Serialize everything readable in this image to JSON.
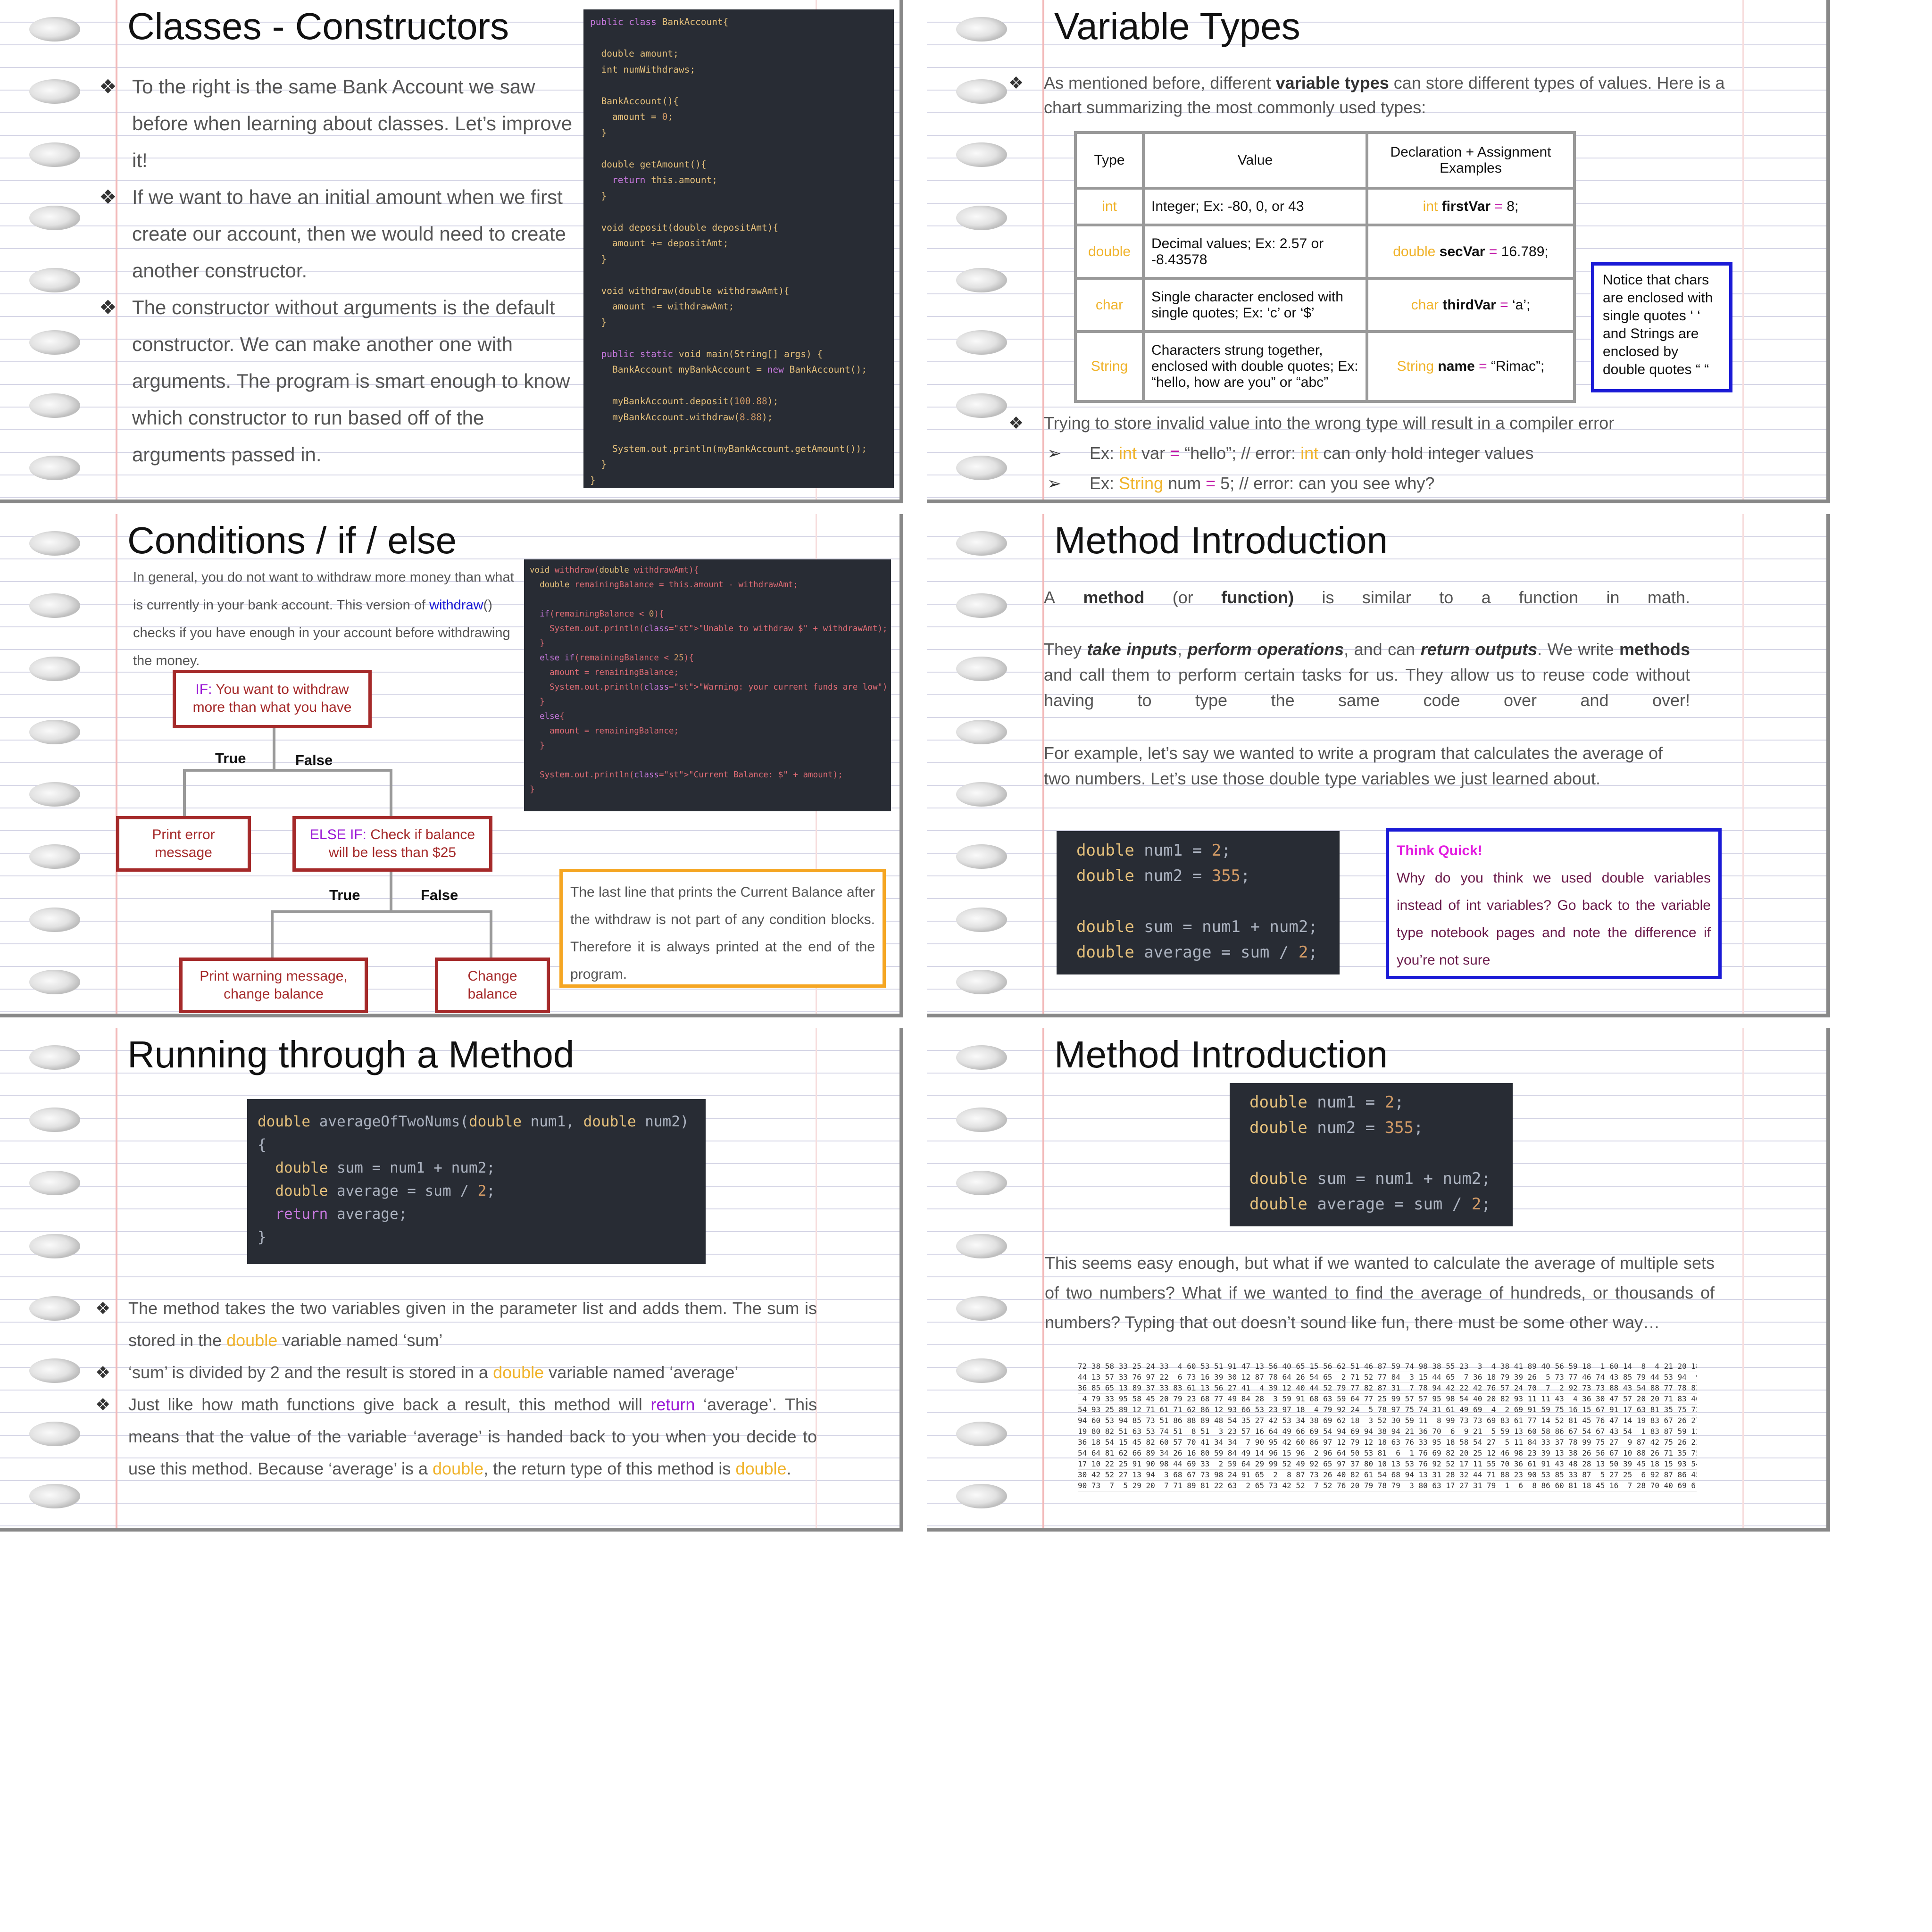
{
  "slides": {
    "constructors": {
      "title": "Classes - Constructors",
      "bullets": [
        "To the right is the same Bank Account we saw before when learning about classes. Let’s improve it!",
        "If we want to have an initial amount when we first create our account, then we would need to create another constructor.",
        "The constructor without arguments is the default constructor. We can make another one with arguments. The program is smart enough to know which constructor to run based off of the arguments passed in."
      ],
      "code": [
        "public class BankAccount{",
        "",
        "  double amount;",
        "  int numWithdraws;",
        "",
        "  BankAccount(){",
        "    amount = 0;",
        "  }",
        "",
        "  double getAmount(){",
        "    return this.amount;",
        "  }",
        "",
        "  void deposit(double depositAmt){",
        "    amount += depositAmt;",
        "  }",
        "",
        "  void withdraw(double withdrawAmt){",
        "    amount -= withdrawAmt;",
        "  }",
        "",
        "  public static void main(String[] args) {",
        "    BankAccount myBankAccount = new BankAccount();",
        "",
        "    myBankAccount.deposit(100.88);",
        "    myBankAccount.withdraw(8.88);",
        "",
        "    System.out.println(myBankAccount.getAmount());",
        "  }",
        "}"
      ]
    },
    "variable_types": {
      "title": "Variable Types",
      "intro_before": "As mentioned before, different ",
      "intro_bold": "variable types",
      "intro_after": " can store different types of values. Here is a chart summarizing the most commonly used types:",
      "table_headers": [
        "Type",
        "Value",
        "Declaration + Assignment Examples"
      ],
      "rows": [
        {
          "type": "int",
          "value": "Integer; Ex: -80, 0, or 43",
          "decl_type": "int",
          "decl_name": "firstVar",
          "decl_eq": "=",
          "decl_val": "8;"
        },
        {
          "type": "double",
          "value": "Decimal values; Ex: 2.57 or -8.43578",
          "decl_type": "double",
          "decl_name": "secVar",
          "decl_eq": "=",
          "decl_val": "16.789;"
        },
        {
          "type": "char",
          "value": "Single character enclosed with single quotes; Ex: ‘c’ or ‘$’",
          "decl_type": "char",
          "decl_name": "thirdVar",
          "decl_eq": "=",
          "decl_val": "‘a’;"
        },
        {
          "type": "String",
          "value": "Characters strung together, enclosed with double quotes; Ex: “hello, how are you” or “abc”",
          "decl_type": "String",
          "decl_name": "name",
          "decl_eq": "=",
          "decl_val": "“Rimac”;"
        }
      ],
      "note": "Notice that chars are enclosed with single quotes ‘ ‘ and Strings are enclosed by double quotes “ “",
      "error_bullet": "Trying to store invalid value into the wrong type will result in a compiler error",
      "ex1": {
        "a": "Ex: ",
        "b": "int",
        "c": " var ",
        "d": "=",
        "e": " “hello”; // error: ",
        "f": "int",
        "g": " can only hold integer values"
      },
      "ex2": {
        "a": "Ex: ",
        "b": "String",
        "c": " num ",
        "d": "=",
        "e": " 5; // error: can you see why?"
      }
    },
    "conditions": {
      "title": "Conditions / if / else",
      "intro_before": "In general, you do not want to withdraw more money than what is currently in your bank account. This version of ",
      "intro_link": "withdraw",
      "intro_after": "() checks if you have enough in your account before withdrawing the money.",
      "if_label": "IF:",
      "if_text": " You want to withdraw more than what you have",
      "true_label": "True",
      "false_label": "False",
      "print_error": "Print error message",
      "elseif_label": "ELSE IF:",
      "elseif_text": " Check if balance will be less than $25",
      "print_warning": "Print warning message, change balance",
      "change_balance": "Change balance",
      "note": "The last line that prints the Current Balance after the withdraw is not part of any condition blocks. Therefore it is always printed at the end of the program.",
      "code": [
        "void withdraw(double withdrawAmt){",
        "  double remainingBalance = this.amount - withdrawAmt;",
        "",
        "  if(remainingBalance < 0){",
        "    System.out.println(\"Unable to withdraw $\" + withdrawAmt);",
        "  }",
        "  else if(remainingBalance < 25){",
        "    amount = remainingBalance;",
        "    System.out.println(\"Warning: your current funds are low\")",
        "  }",
        "  else{",
        "    amount = remainingBalance;",
        "  }",
        "",
        "  System.out.println(\"Current Balance: $\" + amount);",
        "}"
      ]
    },
    "method_intro": {
      "title": "Method Introduction",
      "p1": [
        "A",
        "method",
        "(or",
        "function)",
        "is",
        "similar",
        "to",
        "a",
        "function",
        "in",
        "math."
      ],
      "p2_parts": [
        "They ",
        "take inputs",
        ", ",
        "perform operations",
        ", and can ",
        "return outputs",
        ". We write ",
        "methods",
        " and call them to perform certain tasks for us. They allow us to reuse code without having to type the same code over and over!"
      ],
      "p3": "For example, let’s say we wanted to write a program that calculates the average of two numbers. Let’s use those double type variables we just learned about.",
      "code": [
        "double num1 = 2;",
        "double num2 = 355;",
        "",
        "double sum = num1 + num2;",
        "double average = sum / 2;"
      ],
      "think_title": "Think Quick!",
      "think_text": "Why do you think we used double variables instead of int variables? Go back to the variable type notebook pages and note the difference if you’re not sure"
    },
    "running": {
      "title": "Running through a Method",
      "code": [
        "double averageOfTwoNums(double num1, double num2)",
        "{",
        "  double sum = num1 + num2;",
        "  double average = sum / 2;",
        "  return average;",
        "}"
      ],
      "b1_a": "The method takes the two variables given in the parameter list and adds them. The sum is stored in the ",
      "b1_b": "double",
      "b1_c": " variable named ‘sum’",
      "b2_a": "‘sum’ is divided by 2 and the result is stored in a ",
      "b2_b": "double",
      "b2_c": " variable named ‘average’",
      "b3_a": "Just like how math functions give back a result, this method will ",
      "b3_b": "return",
      "b3_c": " ‘average’. This means that the value of the variable ‘average’ is handed back to you when you decide to use this method. Because ‘average’ is a ",
      "b3_d": "double",
      "b3_e": ", the return type of this method is ",
      "b3_f": "double",
      "b3_g": "."
    },
    "method_intro2": {
      "title": "Method Introduction",
      "code": [
        "double num1 = 2;",
        "double num2 = 355;",
        "",
        "double sum = num1 + num2;",
        "double average = sum / 2;"
      ],
      "para": "This seems easy enough, but what if we wanted to calculate the average of multiple sets of two numbers? What if we wanted to find the average of hundreds, or thousands of numbers? Typing that out doesn’t sound like fun, there must be some other way…",
      "number_grid": [
        "72 38 58 33 25 24 33  4 60 53 51 91 47 13 56 40 65 15 56 62 51 46 87 59 74 98 38 55 23  3  4 38 41 89 40 56 59 18  1 60 14  8  4 21 20 18 26 3",
        "44 13 57 33 76 97 22  6 73 16 39 30 12 87 78 64 26 54 65  2 71 52 77 84  3 15 44 65  7 36 18 79 39 26  5 73 77 46 74 43 85 79 44 53 94  9 95 5",
        "36 85 65 13 89 37 33 83 61 13 56 27 41  4 39 12 40 44 52 79 77 82 87 31  7 78 94 42 22 42 76 57 24 70  7  2 92 73 73 88 43 54 88 77 78 83 94 7",
        " 4 79 33 95 58 45 20 79 23 68 77 49 84 28  3 59 91 68 63 59 64 77 25 99 57 57 95 98 54 40 20 82 93 11 11 43  4 36 30 47 57 20 20 71 83 46 13 1",
        "54 93 25 89 12 71 61 71 62 86 12 93 66 53 23 97 18  4 79 92 24  5 78 97 75 74 31 61 49 69  4  2 69 91 59 75 16 15 67 91 17 63 81 35 75 72 31 1",
        "94 60 53 94 85 73 51 86 88 89 48 54 35 27 42 53 34 38 69 62 18  3 52 30 59 11  8 99 73 73 69 83 61 77 14 52 81 45 76 47 14 19 83 67 26 27 48 6",
        "19 80 82 51 63 53 74 51  8 51  3 23 57 16 64 49 66 69 54 94 69 94 38 94 21 36 70  6  9 21  5 59 13 60 58 86 67 54 67 43 54  1 83 87 59 12 84 9",
        "36 18 54 15 45 82 60 57 70 41 34 34  7 90 95 42 60 86 97 12 79 12 18 63 76 33 95 18 58 54 27  5 11 84 33 37 78 99 75 27  9 87 42 75 26 23 4",
        "54 64 81 62 66 89 34 26 16 80 59 84 49 14 96 15 96  2 96 64 50 53 81  6  1 76 69 82 20 25 12 46 98 23 39 13 38 26 56 67 10 88 26 71 35 75 56 5",
        "17 10 22 25 91 90 98 44 69 33  2 59 64 29 99 52 49 92 65 97 37 80 10 13 53 76 92 52 17 11 55 70 36 61 91 43 48 28 13 50 39 45 18 15 93 54 78 94 2",
        "30 42 52 27 13 94  3 68 67 73 98 24 91 65  2  8 87 73 26 40 82 61 54 68 94 13 31 28 32 44 71 88 23 90 53 85 33 87  5 27 25  6 92 87 86 45 93 9",
        "90 73  7  5 29 20  7 71 89 81 22 63  2 65 73 42 52  7 52 76 20 79 78 79  3 80 63 17 27 31 79  1  6  8 86 60 81 18 45 16  7 28 70 40 69 61 97 8"
      ]
    }
  }
}
